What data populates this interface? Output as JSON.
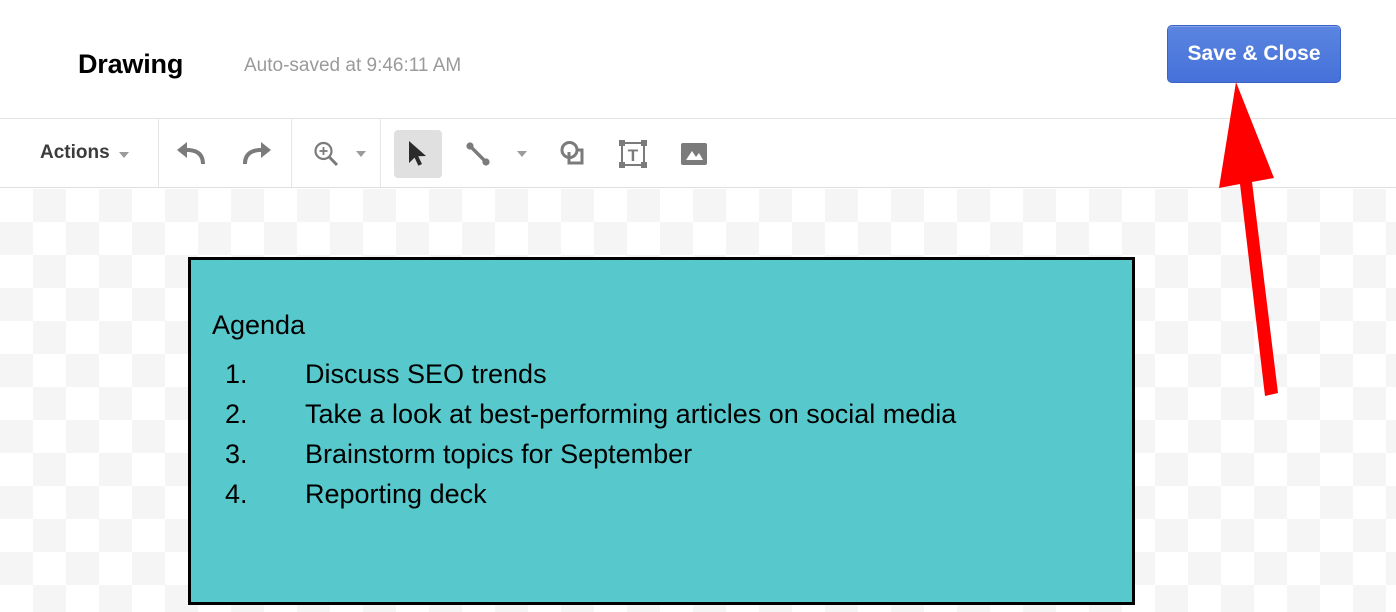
{
  "header": {
    "doc_title": "Drawing",
    "autosave_status": "Auto-saved at 9:46:11 AM",
    "save_close_label": "Save & Close"
  },
  "toolbar": {
    "actions_label": "Actions",
    "tools": [
      {
        "name": "undo",
        "label": "Undo"
      },
      {
        "name": "redo",
        "label": "Redo"
      },
      {
        "name": "zoom",
        "label": "Zoom"
      },
      {
        "name": "select",
        "label": "Select",
        "active": true
      },
      {
        "name": "line",
        "label": "Line"
      },
      {
        "name": "shape",
        "label": "Shape"
      },
      {
        "name": "text-box",
        "label": "Text box"
      },
      {
        "name": "image",
        "label": "Image"
      }
    ]
  },
  "canvas": {
    "shape": {
      "fill_color": "#57c9cc",
      "border_color": "#000000",
      "title": "Agenda",
      "items": [
        {
          "number": "1.",
          "text": "Discuss SEO trends"
        },
        {
          "number": "2.",
          "text": "Take a look at best-performing articles on social media"
        },
        {
          "number": "3.",
          "text": "Brainstorm topics for September"
        },
        {
          "number": "4.",
          "text": "Reporting deck"
        }
      ]
    }
  },
  "annotation": {
    "arrow_color": "#fe0000",
    "points_to": "Save & Close"
  }
}
